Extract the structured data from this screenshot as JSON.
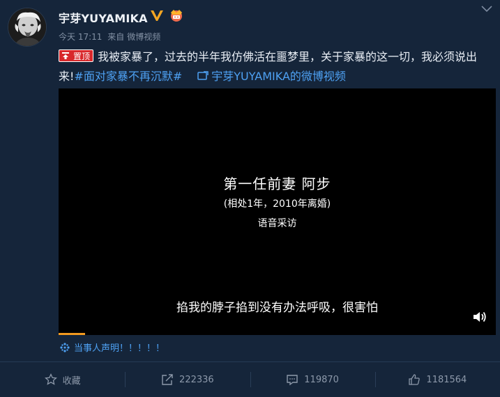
{
  "post": {
    "username": "宇芽YUYAMIKA",
    "time": "今天 17:11",
    "source_prefix": "来自",
    "source": "微博视频",
    "pin_label": "置顶",
    "text_main": "我被家暴了，过去的半年我仿佛活在噩梦里，关于家暴的这一切，我必须说出来!",
    "hashtag": "#面对家暴不再沉默#",
    "video_link": "宇芽YUYAMIKA的微博视频",
    "statement": "当事人声明！！！！！"
  },
  "video": {
    "title": "第一任前妻  阿步",
    "subtitle": "(相处1年，2010年离婚)",
    "note": "语音采访",
    "caption": "掐我的脖子掐到没有办法呼吸，很害怕",
    "progress": 0.06
  },
  "actions": {
    "favorite": "收藏",
    "repost": "222336",
    "comment": "119870",
    "like": "1181564"
  },
  "icons": [
    "chevron-down-icon",
    "verified-icon",
    "vip-icon",
    "pin-icon",
    "video-link-icon",
    "volume-icon",
    "sparkle-icon",
    "star-icon",
    "repost-icon",
    "comment-icon",
    "like-icon"
  ],
  "colors": {
    "background": "#15253a",
    "link": "#4ea1f3",
    "pin": "#d8282b",
    "progress": "#f29a1f",
    "muted": "#8d99aa"
  }
}
